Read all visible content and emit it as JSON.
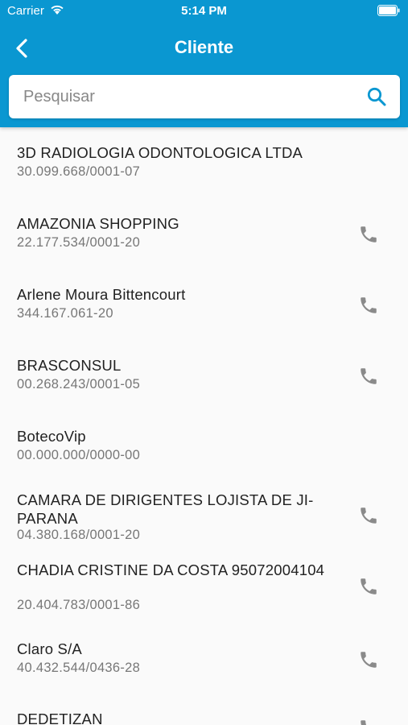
{
  "status": {
    "carrier": "Carrier",
    "time": "5:14 PM"
  },
  "nav": {
    "title": "Cliente",
    "back_icon": "chevron-left-icon"
  },
  "search": {
    "placeholder": "Pesquisar",
    "value": "",
    "icon": "search-icon"
  },
  "colors": {
    "header": "#0a97d1",
    "icon_gray": "#8a8a8a"
  },
  "clients": [
    {
      "name": "3D RADIOLOGIA ODONTOLOGICA LTDA",
      "doc": "30.099.668/0001-07",
      "has_phone": false
    },
    {
      "name": "AMAZONIA SHOPPING",
      "doc": "22.177.534/0001-20",
      "has_phone": true
    },
    {
      "name": "Arlene Moura Bittencourt",
      "doc": "344.167.061-20",
      "has_phone": true
    },
    {
      "name": "BRASCONSUL",
      "doc": "00.268.243/0001-05",
      "has_phone": true
    },
    {
      "name": "BotecoVip",
      "doc": "00.000.000/0000-00",
      "has_phone": false
    },
    {
      "name": "CAMARA DE DIRIGENTES LOJISTA DE JI-PARANA",
      "doc": "04.380.168/0001-20",
      "has_phone": true
    },
    {
      "name": "CHADIA CRISTINE DA COSTA 95072004104",
      "doc": "20.404.783/0001-86",
      "has_phone": true
    },
    {
      "name": "Claro S/A",
      "doc": "40.432.544/0436-28",
      "has_phone": true
    },
    {
      "name": "DEDETIZAN",
      "doc": "",
      "has_phone": true
    }
  ]
}
